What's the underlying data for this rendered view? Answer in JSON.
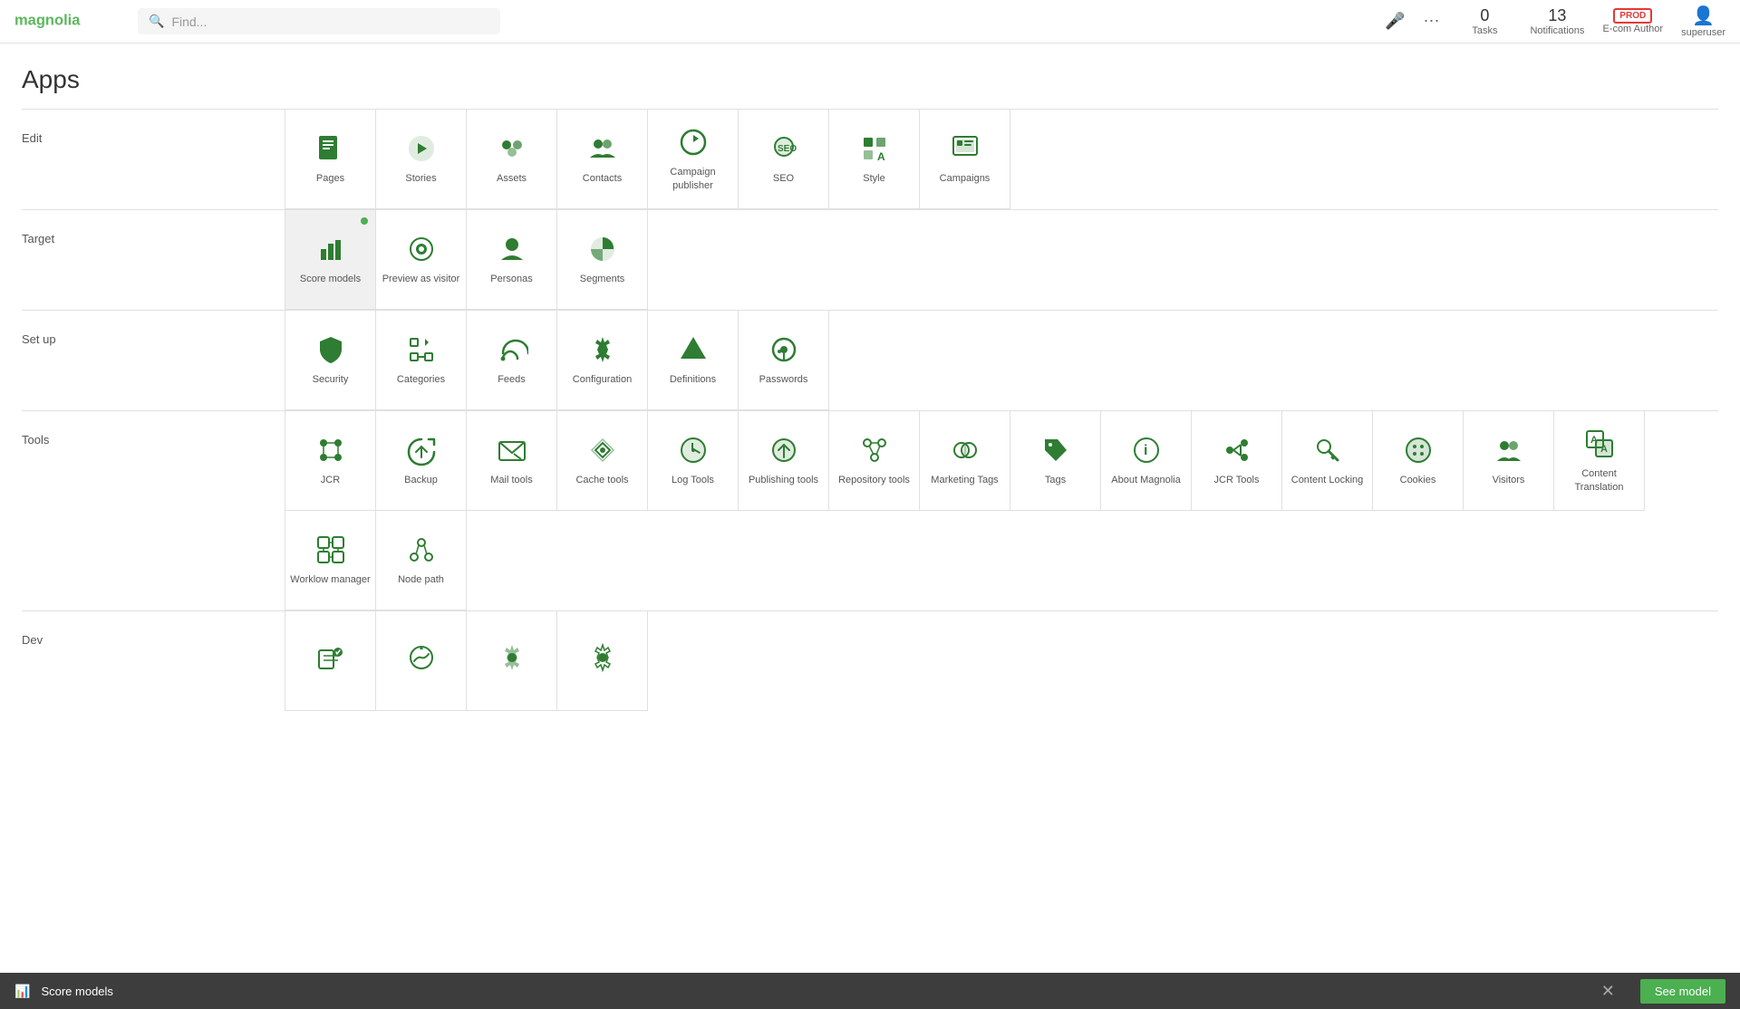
{
  "header": {
    "search_placeholder": "Find...",
    "tasks_label": "Tasks",
    "tasks_count": "0",
    "notifications_label": "Notifications",
    "notifications_count": "13",
    "env_label": "E-com Author",
    "env_badge": "PROD",
    "user_label": "superuser"
  },
  "page_title": "Apps",
  "sections": [
    {
      "label": "Edit",
      "apps": [
        {
          "id": "pages",
          "label": "Pages",
          "icon": "pages"
        },
        {
          "id": "stories",
          "label": "Stories",
          "icon": "stories"
        },
        {
          "id": "assets",
          "label": "Assets",
          "icon": "assets"
        },
        {
          "id": "contacts",
          "label": "Contacts",
          "icon": "contacts"
        },
        {
          "id": "campaign-publisher",
          "label": "Campaign publisher",
          "icon": "campaign-publisher"
        },
        {
          "id": "seo",
          "label": "SEO",
          "icon": "seo"
        },
        {
          "id": "style",
          "label": "Style",
          "icon": "style"
        },
        {
          "id": "campaigns",
          "label": "Campaigns",
          "icon": "campaigns"
        }
      ]
    },
    {
      "label": "Target",
      "apps": [
        {
          "id": "score-models",
          "label": "Score models",
          "icon": "score-models",
          "active": true
        },
        {
          "id": "preview-as-visitor",
          "label": "Preview as visitor",
          "icon": "preview-as-visitor"
        },
        {
          "id": "personas",
          "label": "Personas",
          "icon": "personas"
        },
        {
          "id": "segments",
          "label": "Segments",
          "icon": "segments"
        }
      ]
    },
    {
      "label": "Set up",
      "apps": [
        {
          "id": "security",
          "label": "Security",
          "icon": "security"
        },
        {
          "id": "categories",
          "label": "Categories",
          "icon": "categories"
        },
        {
          "id": "feeds",
          "label": "Feeds",
          "icon": "feeds"
        },
        {
          "id": "configuration",
          "label": "Configuration",
          "icon": "configuration"
        },
        {
          "id": "definitions",
          "label": "Definitions",
          "icon": "definitions"
        },
        {
          "id": "passwords",
          "label": "Passwords",
          "icon": "passwords"
        }
      ]
    },
    {
      "label": "Tools",
      "apps": [
        {
          "id": "jcr",
          "label": "JCR",
          "icon": "jcr"
        },
        {
          "id": "backup",
          "label": "Backup",
          "icon": "backup"
        },
        {
          "id": "mail-tools",
          "label": "Mail tools",
          "icon": "mail-tools"
        },
        {
          "id": "cache-tools",
          "label": "Cache tools",
          "icon": "cache-tools"
        },
        {
          "id": "log-tools",
          "label": "Log Tools",
          "icon": "log-tools"
        },
        {
          "id": "publishing-tools",
          "label": "Publishing tools",
          "icon": "publishing-tools"
        },
        {
          "id": "repository-tools",
          "label": "Repository tools",
          "icon": "repository-tools"
        },
        {
          "id": "marketing-tags",
          "label": "Marketing Tags",
          "icon": "marketing-tags"
        },
        {
          "id": "tags",
          "label": "Tags",
          "icon": "tags"
        },
        {
          "id": "about-magnolia",
          "label": "About Magnolia",
          "icon": "about-magnolia"
        },
        {
          "id": "jcr-tools",
          "label": "JCR Tools",
          "icon": "jcr-tools"
        },
        {
          "id": "content-locking",
          "label": "Content Locking",
          "icon": "content-locking"
        },
        {
          "id": "cookies",
          "label": "Cookies",
          "icon": "cookies"
        },
        {
          "id": "visitors",
          "label": "Visitors",
          "icon": "visitors"
        },
        {
          "id": "content-translation",
          "label": "Content Translation",
          "icon": "content-translation"
        },
        {
          "id": "workflow-manager",
          "label": "Worklow manager",
          "icon": "workflow-manager"
        },
        {
          "id": "node-path",
          "label": "Node path",
          "icon": "node-path"
        }
      ]
    },
    {
      "label": "Dev",
      "apps": [
        {
          "id": "dev-app1",
          "label": "",
          "icon": "dev1"
        },
        {
          "id": "dev-app2",
          "label": "",
          "icon": "dev2"
        },
        {
          "id": "dev-app3",
          "label": "",
          "icon": "dev3"
        },
        {
          "id": "dev-app4",
          "label": "",
          "icon": "dev4"
        }
      ]
    }
  ],
  "bottom_bar": {
    "label": "Score models",
    "action": "See model"
  }
}
